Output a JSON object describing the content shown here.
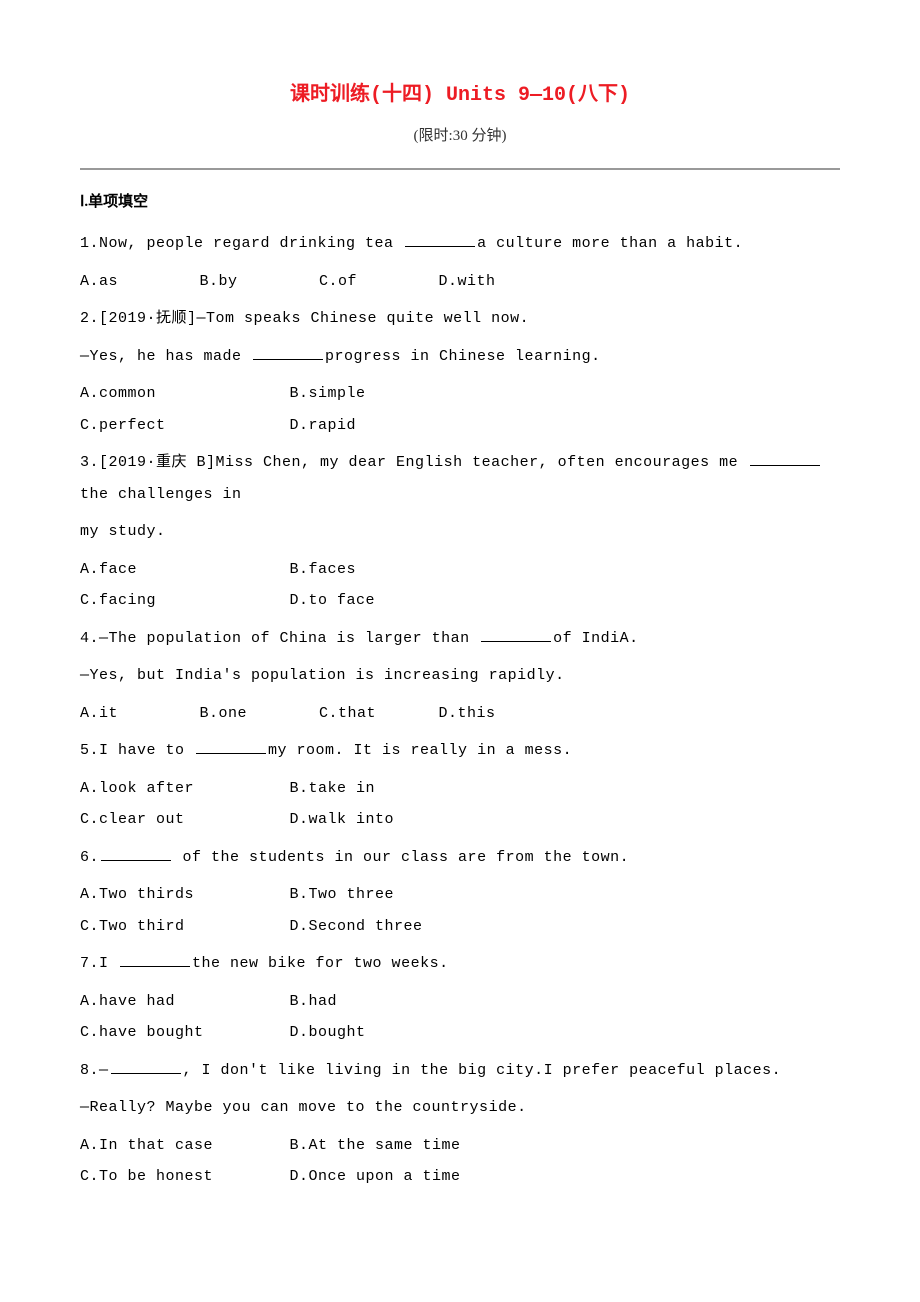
{
  "title": "课时训练(十四)  Units 9—10(八下)",
  "subtitle": "(限时:30 分钟)",
  "section1": {
    "header": "Ⅰ.单项填空",
    "questions": [
      {
        "num": "1.",
        "pre": "Now, people regard drinking tea ",
        "post": "a culture more than a habit.",
        "opts": [
          "A.as",
          "B.by",
          "C.of",
          "D.with"
        ],
        "layout": "inline"
      },
      {
        "num": "2.",
        "source": "[2019·抚顺]",
        "line1": "—Tom speaks Chinese quite well now.",
        "line2_pre": "—Yes, he has made ",
        "line2_post": "progress in Chinese learning.",
        "opts": [
          "A.common",
          "B.simple",
          "C.perfect",
          "D.rapid"
        ],
        "layout": "twocol"
      },
      {
        "num": "3.",
        "source": "[2019·重庆 B]",
        "pre": "Miss Chen, my dear English teacher, often encourages me ",
        "post": "the challenges in",
        "contline": "my study.",
        "opts": [
          "A.face",
          "B.faces",
          "C.facing",
          "D.to face"
        ],
        "layout": "twocol"
      },
      {
        "num": "4.",
        "line1_pre": "—The population of China is larger than ",
        "line1_post": "of IndiA.",
        "line2": "—Yes, but India's population is increasing rapidly.",
        "opts": [
          "A.it",
          "B.one",
          "C.that",
          "D.this"
        ],
        "layout": "inline"
      },
      {
        "num": "5.",
        "pre": "I have to ",
        "post": "my room. It is really in a mess.",
        "opts": [
          "A.look after",
          "B.take in",
          "C.clear out",
          "D.walk into"
        ],
        "layout": "twocol"
      },
      {
        "num": "6.",
        "pre": "",
        "post": " of the students in our class are from the town.",
        "opts": [
          "A.Two thirds",
          "B.Two three",
          "C.Two third",
          "D.Second three"
        ],
        "layout": "twocol"
      },
      {
        "num": "7.",
        "pre": "I ",
        "post": "the new bike for two weeks.",
        "opts": [
          "A.have had",
          "B.had",
          "C.have bought",
          "D.bought"
        ],
        "layout": "twocol"
      },
      {
        "num": "8.",
        "line1_pre": "—",
        "line1_post": ", I don't like living in the big city.I prefer peaceful places.",
        "line2": "—Really? Maybe you can move to the countryside.",
        "opts": [
          "A.In that case",
          "B.At the same time",
          "C.To be honest",
          "D.Once upon a time"
        ],
        "layout": "twocol"
      }
    ]
  }
}
